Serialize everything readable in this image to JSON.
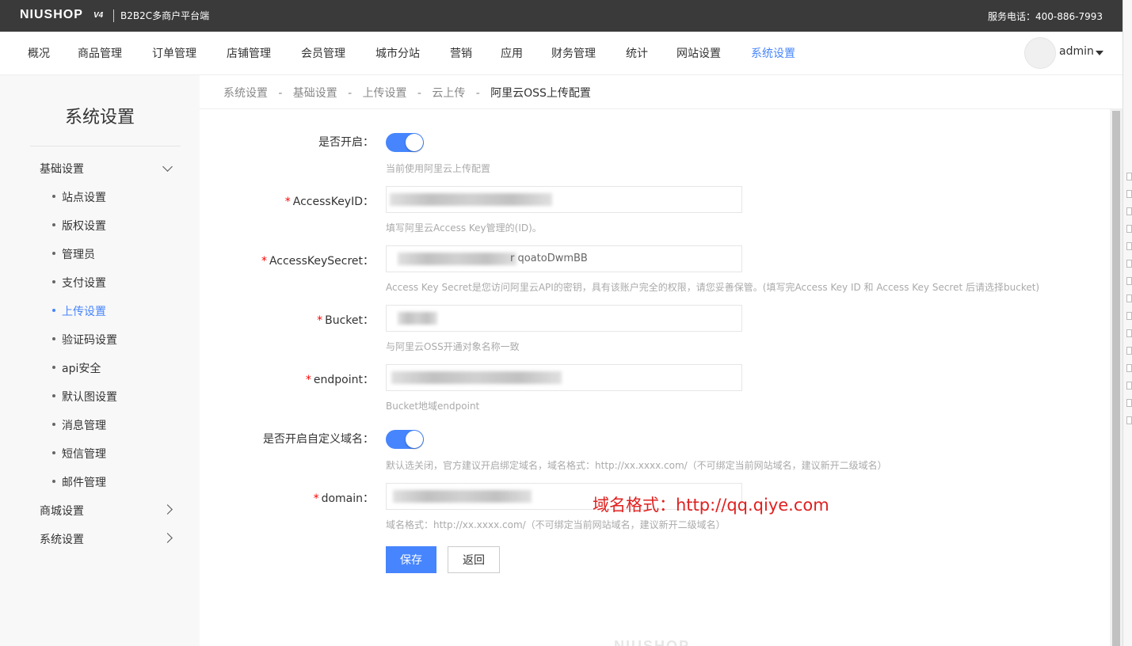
{
  "header": {
    "logo": "NIUSHOP",
    "logo_version": "V4",
    "platform": "B2B2C多商户平台端",
    "service_phone": "服务电话：400-886-7993"
  },
  "nav": {
    "items": [
      "概况",
      "商品管理",
      "订单管理",
      "店铺管理",
      "会员管理",
      "城市分站",
      "营销",
      "应用",
      "财务管理",
      "统计",
      "网站设置",
      "系统设置"
    ],
    "active": "系统设置",
    "user": "admin"
  },
  "sidebar": {
    "title": "系统设置",
    "groups": [
      {
        "label": "基础设置",
        "expanded": true
      },
      {
        "label": "商城设置",
        "expanded": false
      },
      {
        "label": "系统设置",
        "expanded": false
      }
    ],
    "items": [
      "站点设置",
      "版权设置",
      "管理员",
      "支付设置",
      "上传设置",
      "验证码设置",
      "api安全",
      "默认图设置",
      "消息管理",
      "短信管理",
      "邮件管理"
    ],
    "active_item": "上传设置"
  },
  "breadcrumb": {
    "items": [
      "系统设置",
      "基础设置",
      "上传设置",
      "云上传",
      "阿里云OSS上传配置"
    ],
    "separator": "-"
  },
  "form": {
    "enable": {
      "label": "是否开启：",
      "on": true,
      "hint": "当前使用阿里云上传配置"
    },
    "access_key_id": {
      "label": "AccessKeyID：",
      "hint": "填写阿里云Access Key管理的(ID)。"
    },
    "access_key_secret": {
      "label": "AccessKeySecret：",
      "value_suffix": "r qoatoDwmBB",
      "hint": "Access Key Secret是您访问阿里云API的密钥，具有该账户完全的权限，请您妥善保管。(填写完Access Key ID 和 Access Key Secret 后请选择bucket)"
    },
    "bucket": {
      "label": "Bucket：",
      "hint": "与阿里云OSS开通对象名称一致"
    },
    "endpoint": {
      "label": "endpoint：",
      "hint": "Bucket地域endpoint"
    },
    "custom_domain": {
      "label": "是否开启自定义域名：",
      "on": true,
      "hint": "默认选关闭，官方建议开启绑定域名，域名格式：http://xx.xxxx.com/（不可绑定当前网站域名，建议新开二级域名）"
    },
    "domain": {
      "label": "domain：",
      "hint": "域名格式：http://xx.xxxx.com/（不可绑定当前网站域名，建议新开二级域名）"
    },
    "required_mark": "*"
  },
  "buttons": {
    "save": "保存",
    "back": "返回"
  },
  "annotation": "域名格式：http://qq.qiye.com",
  "footer_watermark": "NIUSHOP",
  "colors": {
    "accent": "#4685FD",
    "topbar": "#3a3a3a",
    "required": "#ff0000",
    "annotation": "#e02020"
  }
}
